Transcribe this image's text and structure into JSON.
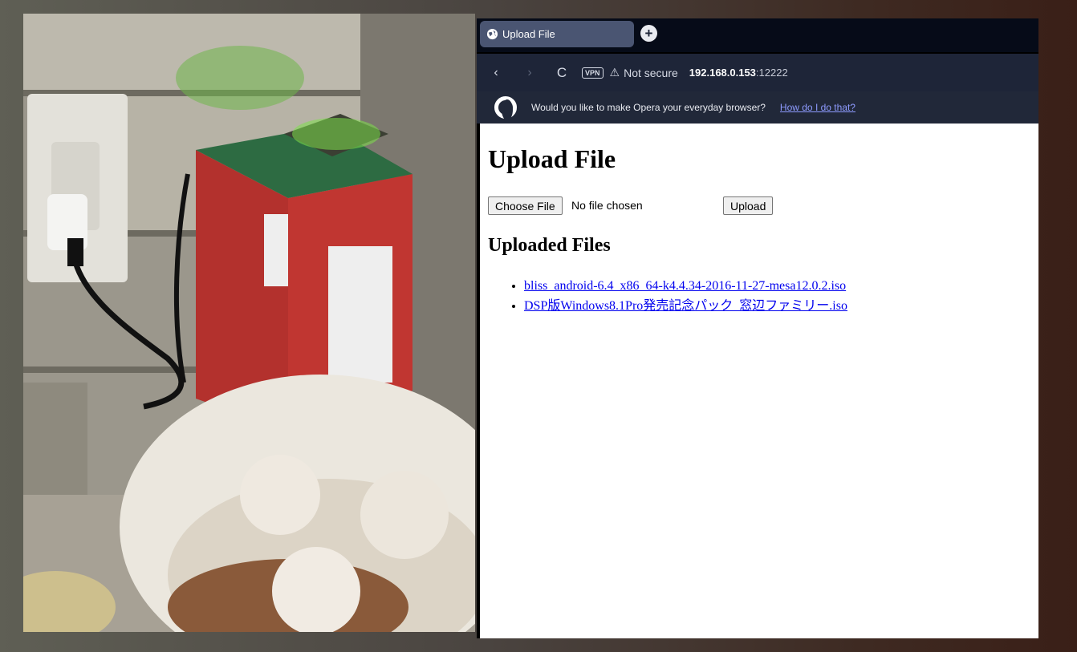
{
  "photo": {
    "description_label": "Raspberry Pi on box"
  },
  "browser": {
    "tab": {
      "title": "Upload File"
    },
    "new_tab_symbol": "+",
    "address": {
      "back_symbol": "‹",
      "forward_symbol": "›",
      "reload_symbol": "C",
      "vpn_badge": "VPN",
      "warning_symbol": "⚠",
      "security_text": "Not secure",
      "host": "192.168.0.153",
      "port": ":12222"
    },
    "promo": {
      "text": "Would you like to make Opera your everyday browser?",
      "link": "How do I do that?"
    }
  },
  "page": {
    "title": "Upload File",
    "choose_file_label": "Choose File",
    "no_file_text": "No file chosen",
    "upload_label": "Upload",
    "files_heading": "Uploaded Files",
    "files": [
      "bliss_android-6.4_x86_64-k4.4.34-2016-11-27-mesa12.0.2.iso",
      "DSP版Windows8.1Pro発売記念パック_窓辺ファミリー.iso"
    ]
  },
  "colors": {
    "tabbar_bg": "#060b18",
    "tab_bg": "#4a5572",
    "addressbar_bg": "#1e2538",
    "link_color": "#0000ee",
    "promo_link_color": "#8e9bff"
  }
}
